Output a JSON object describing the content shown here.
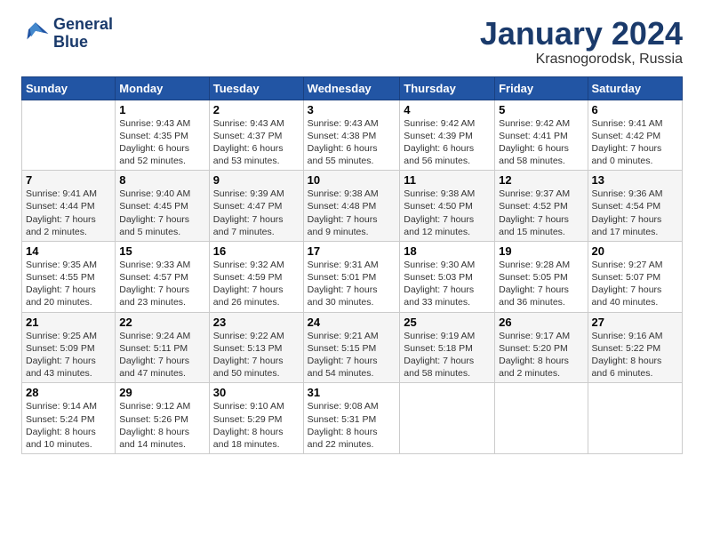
{
  "logo": {
    "line1": "General",
    "line2": "Blue"
  },
  "header": {
    "month": "January 2024",
    "location": "Krasnogorodsk, Russia"
  },
  "weekdays": [
    "Sunday",
    "Monday",
    "Tuesday",
    "Wednesday",
    "Thursday",
    "Friday",
    "Saturday"
  ],
  "weeks": [
    [
      {
        "day": "",
        "info": ""
      },
      {
        "day": "1",
        "info": "Sunrise: 9:43 AM\nSunset: 4:35 PM\nDaylight: 6 hours\nand 52 minutes."
      },
      {
        "day": "2",
        "info": "Sunrise: 9:43 AM\nSunset: 4:37 PM\nDaylight: 6 hours\nand 53 minutes."
      },
      {
        "day": "3",
        "info": "Sunrise: 9:43 AM\nSunset: 4:38 PM\nDaylight: 6 hours\nand 55 minutes."
      },
      {
        "day": "4",
        "info": "Sunrise: 9:42 AM\nSunset: 4:39 PM\nDaylight: 6 hours\nand 56 minutes."
      },
      {
        "day": "5",
        "info": "Sunrise: 9:42 AM\nSunset: 4:41 PM\nDaylight: 6 hours\nand 58 minutes."
      },
      {
        "day": "6",
        "info": "Sunrise: 9:41 AM\nSunset: 4:42 PM\nDaylight: 7 hours\nand 0 minutes."
      }
    ],
    [
      {
        "day": "7",
        "info": "Sunrise: 9:41 AM\nSunset: 4:44 PM\nDaylight: 7 hours\nand 2 minutes."
      },
      {
        "day": "8",
        "info": "Sunrise: 9:40 AM\nSunset: 4:45 PM\nDaylight: 7 hours\nand 5 minutes."
      },
      {
        "day": "9",
        "info": "Sunrise: 9:39 AM\nSunset: 4:47 PM\nDaylight: 7 hours\nand 7 minutes."
      },
      {
        "day": "10",
        "info": "Sunrise: 9:38 AM\nSunset: 4:48 PM\nDaylight: 7 hours\nand 9 minutes."
      },
      {
        "day": "11",
        "info": "Sunrise: 9:38 AM\nSunset: 4:50 PM\nDaylight: 7 hours\nand 12 minutes."
      },
      {
        "day": "12",
        "info": "Sunrise: 9:37 AM\nSunset: 4:52 PM\nDaylight: 7 hours\nand 15 minutes."
      },
      {
        "day": "13",
        "info": "Sunrise: 9:36 AM\nSunset: 4:54 PM\nDaylight: 7 hours\nand 17 minutes."
      }
    ],
    [
      {
        "day": "14",
        "info": "Sunrise: 9:35 AM\nSunset: 4:55 PM\nDaylight: 7 hours\nand 20 minutes."
      },
      {
        "day": "15",
        "info": "Sunrise: 9:33 AM\nSunset: 4:57 PM\nDaylight: 7 hours\nand 23 minutes."
      },
      {
        "day": "16",
        "info": "Sunrise: 9:32 AM\nSunset: 4:59 PM\nDaylight: 7 hours\nand 26 minutes."
      },
      {
        "day": "17",
        "info": "Sunrise: 9:31 AM\nSunset: 5:01 PM\nDaylight: 7 hours\nand 30 minutes."
      },
      {
        "day": "18",
        "info": "Sunrise: 9:30 AM\nSunset: 5:03 PM\nDaylight: 7 hours\nand 33 minutes."
      },
      {
        "day": "19",
        "info": "Sunrise: 9:28 AM\nSunset: 5:05 PM\nDaylight: 7 hours\nand 36 minutes."
      },
      {
        "day": "20",
        "info": "Sunrise: 9:27 AM\nSunset: 5:07 PM\nDaylight: 7 hours\nand 40 minutes."
      }
    ],
    [
      {
        "day": "21",
        "info": "Sunrise: 9:25 AM\nSunset: 5:09 PM\nDaylight: 7 hours\nand 43 minutes."
      },
      {
        "day": "22",
        "info": "Sunrise: 9:24 AM\nSunset: 5:11 PM\nDaylight: 7 hours\nand 47 minutes."
      },
      {
        "day": "23",
        "info": "Sunrise: 9:22 AM\nSunset: 5:13 PM\nDaylight: 7 hours\nand 50 minutes."
      },
      {
        "day": "24",
        "info": "Sunrise: 9:21 AM\nSunset: 5:15 PM\nDaylight: 7 hours\nand 54 minutes."
      },
      {
        "day": "25",
        "info": "Sunrise: 9:19 AM\nSunset: 5:18 PM\nDaylight: 7 hours\nand 58 minutes."
      },
      {
        "day": "26",
        "info": "Sunrise: 9:17 AM\nSunset: 5:20 PM\nDaylight: 8 hours\nand 2 minutes."
      },
      {
        "day": "27",
        "info": "Sunrise: 9:16 AM\nSunset: 5:22 PM\nDaylight: 8 hours\nand 6 minutes."
      }
    ],
    [
      {
        "day": "28",
        "info": "Sunrise: 9:14 AM\nSunset: 5:24 PM\nDaylight: 8 hours\nand 10 minutes."
      },
      {
        "day": "29",
        "info": "Sunrise: 9:12 AM\nSunset: 5:26 PM\nDaylight: 8 hours\nand 14 minutes."
      },
      {
        "day": "30",
        "info": "Sunrise: 9:10 AM\nSunset: 5:29 PM\nDaylight: 8 hours\nand 18 minutes."
      },
      {
        "day": "31",
        "info": "Sunrise: 9:08 AM\nSunset: 5:31 PM\nDaylight: 8 hours\nand 22 minutes."
      },
      {
        "day": "",
        "info": ""
      },
      {
        "day": "",
        "info": ""
      },
      {
        "day": "",
        "info": ""
      }
    ]
  ]
}
